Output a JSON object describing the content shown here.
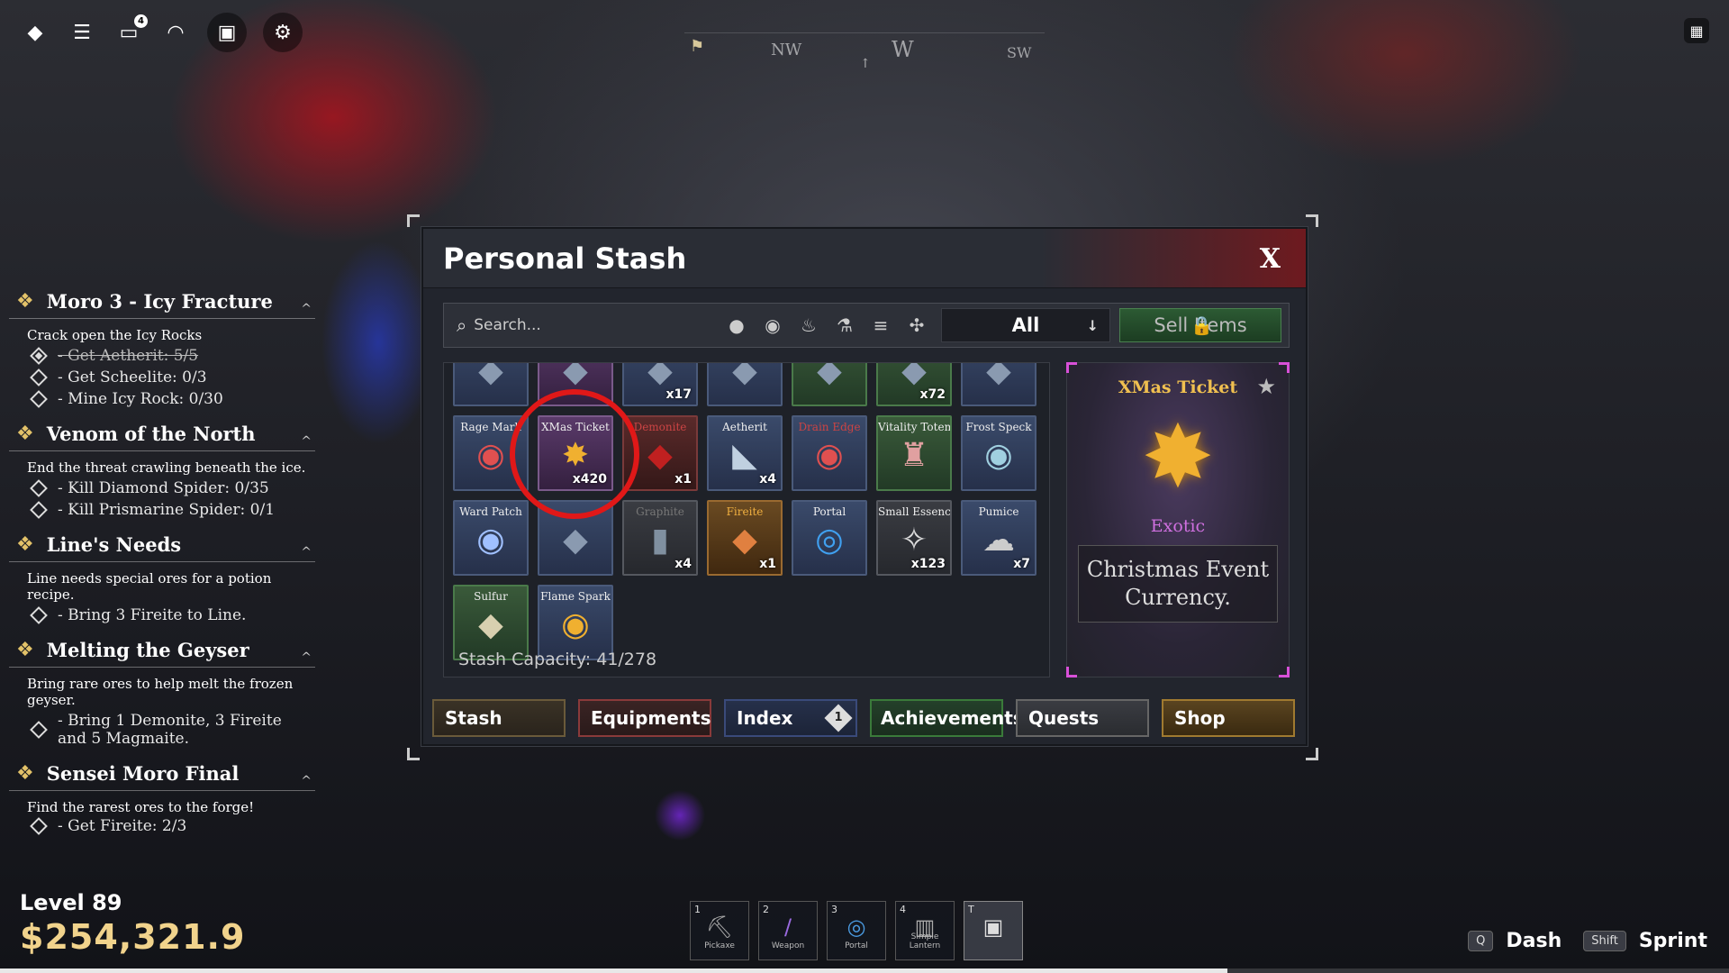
{
  "topbar": {
    "icons": [
      "roblox-logo-icon",
      "menu-icon",
      "chat-icon",
      "headset-icon",
      "backpack-icon",
      "gear-icon"
    ],
    "chat_badge": "4"
  },
  "compass": {
    "nw": "NW",
    "w": "W",
    "sw": "SW"
  },
  "quests": [
    {
      "title": "Moro 3 - Icy Fracture",
      "desc": "Crack open the Icy Rocks",
      "objectives": [
        {
          "text": "- Get Aetherit: 5/5",
          "done": true
        },
        {
          "text": "- Get Scheelite: 0/3",
          "done": false
        },
        {
          "text": "- Mine Icy Rock: 0/30",
          "done": false
        }
      ]
    },
    {
      "title": "Venom of the North",
      "desc": "End the threat crawling beneath the ice.",
      "objectives": [
        {
          "text": "- Kill Diamond Spider: 0/35",
          "done": false
        },
        {
          "text": "- Kill Prismarine Spider: 0/1",
          "done": false
        }
      ]
    },
    {
      "title": "Line's Needs",
      "desc": "Line needs special ores for a potion recipe.",
      "objectives": [
        {
          "text": "- Bring 3 Fireite to Line.",
          "done": false
        }
      ]
    },
    {
      "title": "Melting the Geyser",
      "desc": "Bring rare ores to help melt the frozen geyser.",
      "objectives": [
        {
          "text": "- Bring 1 Demonite, 3 Fireite and 5 Magmaite.",
          "done": false
        }
      ]
    },
    {
      "title": "Sensei Moro Final",
      "desc": "Find the rarest ores to the forge!",
      "objectives": [
        {
          "text": "- Get Fireite: 2/3",
          "done": false
        }
      ]
    }
  ],
  "player": {
    "level": "Level 89",
    "money": "$254,321.9"
  },
  "hotbar": [
    {
      "num": "1",
      "label": "Pickaxe",
      "icon": "pickaxe-icon"
    },
    {
      "num": "2",
      "label": "Weapon",
      "icon": "weapon-icon"
    },
    {
      "num": "3",
      "label": "Portal",
      "icon": "portal-icon"
    },
    {
      "num": "4",
      "label": "Simple Lantern",
      "icon": "lantern-icon"
    },
    {
      "num": "T",
      "label": "",
      "icon": "backpack-icon"
    }
  ],
  "keybinds": [
    {
      "key": "Q",
      "action": "Dash"
    },
    {
      "key": "Shift",
      "action": "Sprint"
    }
  ],
  "stash": {
    "title": "Personal Stash",
    "close": "X",
    "search_placeholder": "Search...",
    "filter_value": "All",
    "sell_label": "Sell Items",
    "capacity": "Stash Capacity: 41/278",
    "tabs": [
      "Stash",
      "Equipments",
      "Index",
      "Achievements",
      "Quests",
      "Shop"
    ],
    "index_badge": "1",
    "items": [
      {
        "name": "",
        "qty": "",
        "rarity": "blue"
      },
      {
        "name": "",
        "qty": "",
        "rarity": "purple"
      },
      {
        "name": "",
        "qty": "x17",
        "rarity": "blue"
      },
      {
        "name": "",
        "qty": "",
        "rarity": "blue"
      },
      {
        "name": "",
        "qty": "",
        "rarity": "green"
      },
      {
        "name": "",
        "qty": "x72",
        "rarity": "green"
      },
      {
        "name": "",
        "qty": "",
        "rarity": "blue"
      },
      {
        "name": "Rage Mark",
        "qty": "",
        "rarity": "blue"
      },
      {
        "name": "XMas Ticket",
        "qty": "x420",
        "rarity": "purple"
      },
      {
        "name": "Demonite",
        "qty": "x1",
        "rarity": "red"
      },
      {
        "name": "Aetherit",
        "qty": "x4",
        "rarity": "blue"
      },
      {
        "name": "Drain Edge",
        "qty": "",
        "rarity": "blue"
      },
      {
        "name": "Vitality Totem I",
        "qty": "",
        "rarity": "green"
      },
      {
        "name": "Frost Speck",
        "qty": "",
        "rarity": "blue"
      },
      {
        "name": "Ward Patch",
        "qty": "",
        "rarity": "blue"
      },
      {
        "name": "",
        "qty": "",
        "rarity": "blue"
      },
      {
        "name": "Graphite",
        "qty": "x4",
        "rarity": "gray"
      },
      {
        "name": "Fireite",
        "qty": "x1",
        "rarity": "orange"
      },
      {
        "name": "Portal",
        "qty": "",
        "rarity": "blue"
      },
      {
        "name": "Small Essence",
        "qty": "x123",
        "rarity": "gray"
      },
      {
        "name": "Pumice",
        "qty": "x7",
        "rarity": "blue"
      },
      {
        "name": "Sulfur",
        "qty": "",
        "rarity": "green"
      },
      {
        "name": "Flame Spark",
        "qty": "",
        "rarity": "blue"
      }
    ],
    "detail": {
      "name": "XMas Ticket",
      "rarity": "Exotic",
      "description": "Christmas Event Currency."
    }
  },
  "accent_colors": {
    "gold": "#f0c050",
    "exotic": "#d070e0",
    "highlight": "#e01818"
  }
}
